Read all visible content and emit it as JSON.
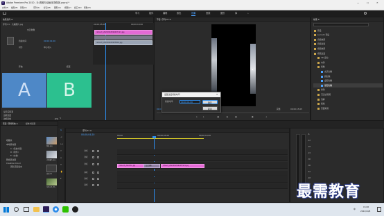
{
  "window": {
    "title": "Adobe Premiere Pro 2020 - D:\\视频与动画\\转场特效.prproj *",
    "controls": [
      "—",
      "□",
      "✕"
    ]
  },
  "menu": [
    "文件(F)",
    "编辑(E)",
    "剪辑(C)",
    "序列(S)",
    "标记(M)",
    "图形(G)",
    "视图(V)",
    "窗口(W)",
    "帮助(H)"
  ],
  "workspaces": [
    "学习",
    "组件",
    "编辑",
    "颜色",
    "效果",
    "音频",
    "图形",
    "库"
  ],
  "workspace_active": "效果",
  "effect_controls": {
    "tab_label": "效果控件 ≡",
    "source_label": "源 · 大美图片.jpg",
    "sequence_label": "序列 01 · 大美图片.jpg",
    "transition_name": "交叉划像",
    "duration_label": "持续时间",
    "duration_value": "00:00:01:00",
    "alignment_label": "对齐",
    "alignment_value": "中心切入",
    "side_a": "A",
    "side_b": "B",
    "properties": [
      "开始",
      "结束",
      "显示实际源",
      "边框宽度",
      "边框颜色",
      "反向",
      "消除锯齿品质"
    ],
    "timecode_left": "00;00;05;00",
    "timecode_right": "00;00;10;00",
    "clip_top": "nitouch_20220913094457121.jpg",
    "clip_bottom": "nitouch_202209130935802.jpg"
  },
  "program": {
    "tab_label": "节目: 序列 01 ≡",
    "timecode": "00;00;04;20",
    "fit": "适合",
    "quality": "完整",
    "duration": "00;00;15;05"
  },
  "effects_panel": {
    "tab_label": "效果 ≡",
    "search_placeholder": "",
    "tree": [
      {
        "label": "预设",
        "level": 0
      },
      {
        "label": "Lumetri 预设",
        "level": 0
      },
      {
        "label": "音频效果",
        "level": 0
      },
      {
        "label": "音频过渡",
        "level": 0
      },
      {
        "label": "视频效果",
        "level": 0
      },
      {
        "label": "视频过渡",
        "level": 0
      },
      {
        "label": "3D 运动",
        "level": 1
      },
      {
        "label": "内滑",
        "level": 1
      },
      {
        "label": "划像",
        "level": 1
      },
      {
        "label": "交叉划像",
        "level": 2
      },
      {
        "label": "圆划像",
        "level": 2
      },
      {
        "label": "盒形划像",
        "level": 2
      },
      {
        "label": "菱形划像",
        "level": 2
      },
      {
        "label": "擦除",
        "level": 1
      },
      {
        "label": "沉浸式视频",
        "level": 1
      },
      {
        "label": "溶解",
        "level": 1
      },
      {
        "label": "缩放",
        "level": 1
      },
      {
        "label": "页面剥落",
        "level": 1
      }
    ],
    "selected": "菱形划像"
  },
  "dialog": {
    "title": "设置过渡持续时间",
    "field_label": "持续时间:",
    "field_value": "00;00;01;00",
    "ok": "确定",
    "cancel": "取消"
  },
  "project": {
    "tab_label": "项目: 转场特效 ≡",
    "tab2": "媒体浏览器",
    "items": [
      "收藏夹",
      "本地驱动器",
      "C: (系统分区)",
      "D: (软件)",
      "E: (文档)",
      "网络驱动器",
      "Creative Cloud",
      "团队项目版本"
    ],
    "thumbs": [
      "风景.jpg",
      "大美图片.jpg",
      "序列 01",
      "nitouch_20…"
    ]
  },
  "timeline": {
    "tab_label": "序列 01 ≡",
    "timecode": "00;00;04;20",
    "ruler": [
      "00;00",
      "00;00;05;00",
      "00;00;10;00"
    ],
    "video_tracks": [
      "V3",
      "V2",
      "V1"
    ],
    "audio_tracks": [
      "A1",
      "A2",
      "A3"
    ],
    "clip_a": "nitouch_202209…jpg",
    "clip_b": "nitouch_20220913094457121.jpg",
    "transition": "交叉划像"
  },
  "audio_meter": {
    "labels": [
      "-6",
      "-12",
      "-18",
      "-24",
      "-30",
      "-36",
      "-42",
      "-48",
      "-54",
      "dB"
    ]
  },
  "taskbar": {
    "time": "15:08",
    "date": "2022/10/8",
    "lang": "中",
    "app_icons": [
      "windows-logo-icon",
      "search-icon",
      "task-view-icon",
      "explorer-icon",
      "premiere-icon",
      "browser-icon",
      "wechat-icon",
      "qq-icon"
    ]
  },
  "watermark": "最需教育",
  "colors": {
    "accent_blue": "#2d8ceb",
    "side_a": "#4e88c7",
    "side_b": "#2cc08f",
    "clip_pink": "#e56ad6",
    "playhead": "#2d8ceb",
    "work_area": "#d6c828"
  }
}
